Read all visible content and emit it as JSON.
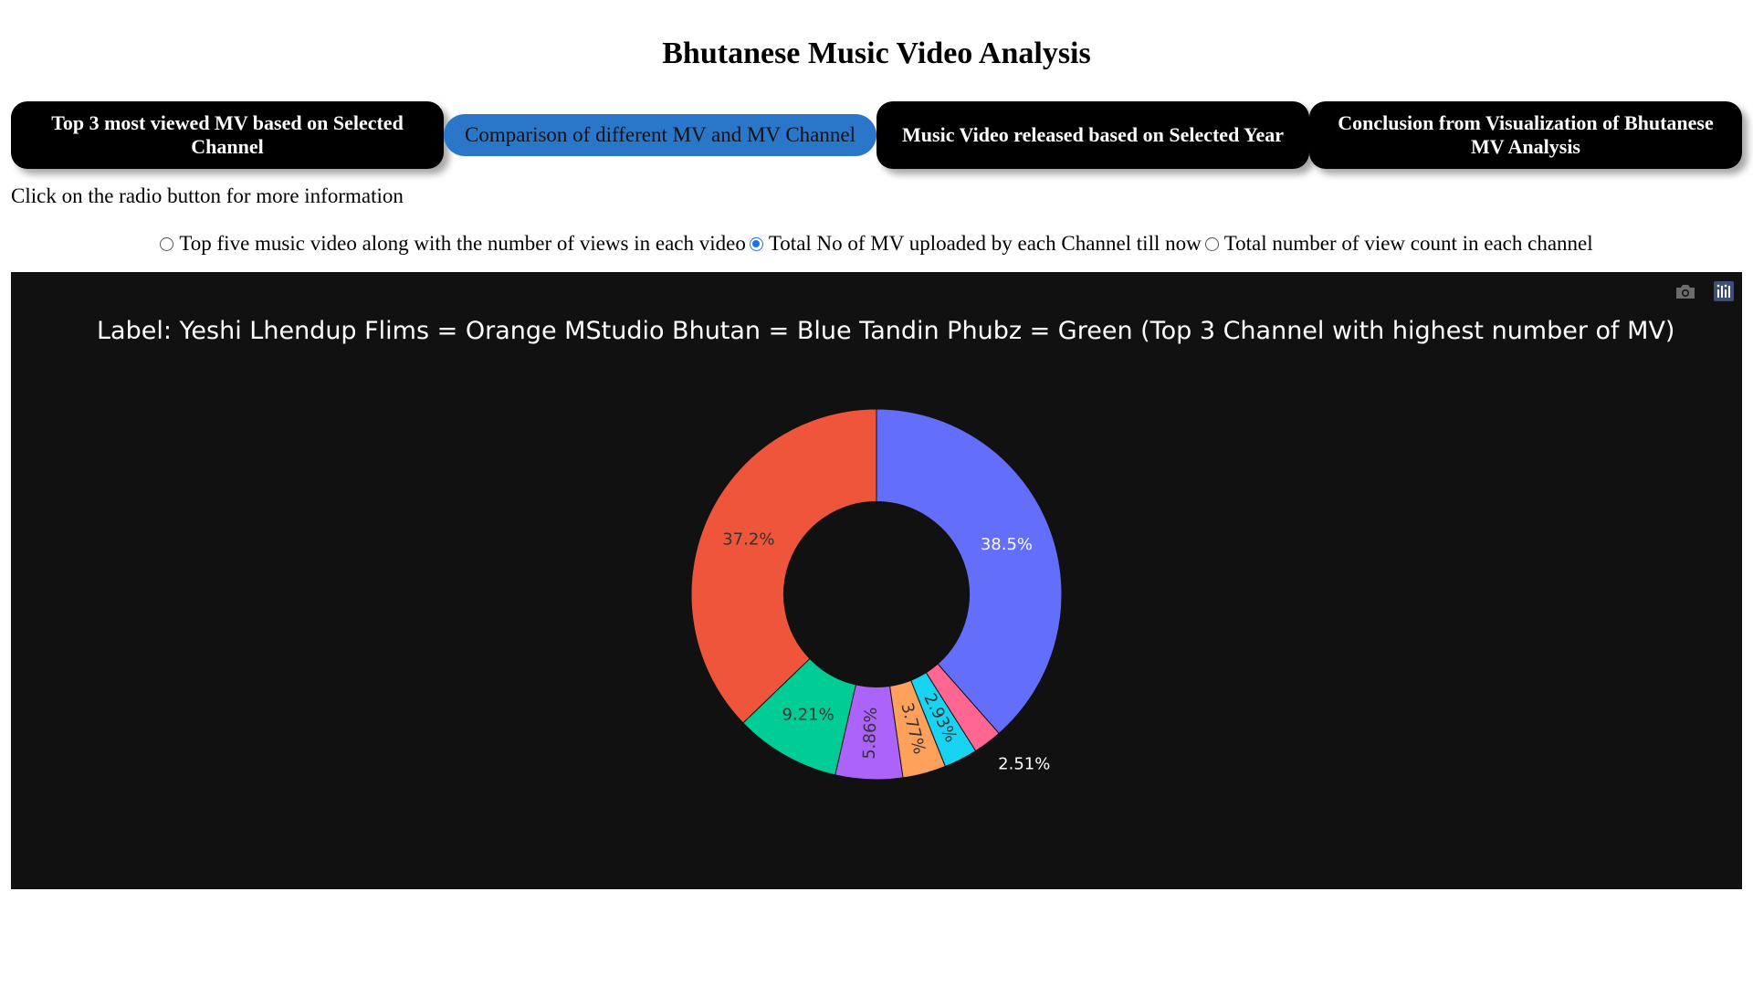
{
  "page": {
    "title": "Bhutanese Music Video Analysis",
    "instruction": "Click on the radio button for more information"
  },
  "tabs": [
    {
      "label": "Top 3 most viewed MV based on Selected Channel",
      "active": false
    },
    {
      "label": "Comparison of different MV and MV Channel",
      "active": true
    },
    {
      "label": "Music Video released based on Selected Year",
      "active": false
    },
    {
      "label": "Conclusion from Visualization of Bhutanese MV Analysis",
      "active": false
    }
  ],
  "radio_options": [
    {
      "label": "Top five music video along with the number of views in each video",
      "checked": false
    },
    {
      "label": "Total No of MV uploaded by each Channel till now",
      "checked": true
    },
    {
      "label": "Total number of view count in each channel",
      "checked": false
    }
  ],
  "modebar": {
    "icons": [
      "camera-icon",
      "plotly-logo-icon"
    ]
  },
  "chart_data": {
    "type": "pie",
    "hole": 0.5,
    "title": "Label: Yeshi Lhendup Flims = Orange  MStudio Bhutan = Blue Tandin Phubz = Green (Top 3 Channel with highest number of MV)",
    "background": "#111111",
    "slices": [
      {
        "value": 38.5,
        "label": "38.5%",
        "color": "#636efa"
      },
      {
        "value": 2.51,
        "label": "2.51%",
        "color": "#ff6692"
      },
      {
        "value": 2.93,
        "label": "2.93%",
        "color": "#19d3f3"
      },
      {
        "value": 3.77,
        "label": "3.77%",
        "color": "#ffa15a"
      },
      {
        "value": 5.86,
        "label": "5.86%",
        "color": "#ab63fa"
      },
      {
        "value": 9.21,
        "label": "9.21%",
        "color": "#00cc96"
      },
      {
        "value": 37.2,
        "label": "37.2%",
        "color": "#ef553b"
      }
    ]
  }
}
